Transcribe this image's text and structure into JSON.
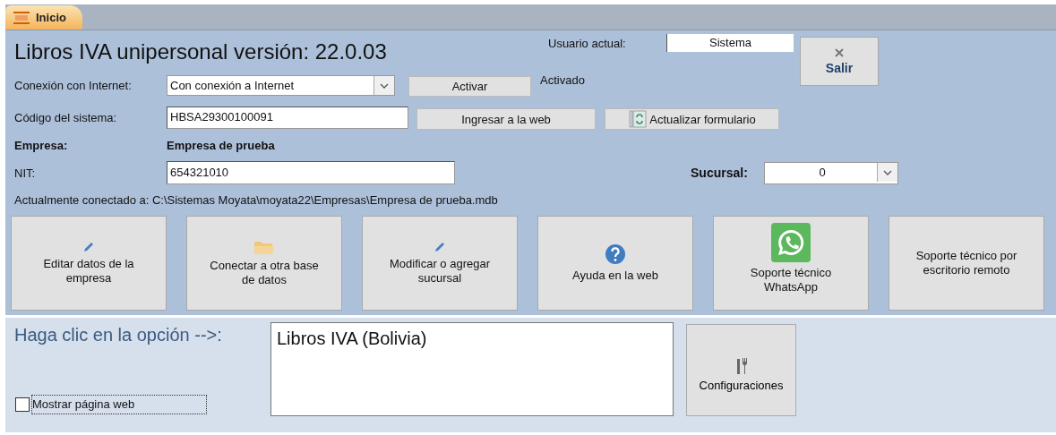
{
  "tabs": [
    {
      "label": "Inicio",
      "selected": true
    }
  ],
  "title": "Libros IVA unipersonal versión: 22.0.03",
  "user": {
    "label": "Usuario actual:",
    "value": "Sistema"
  },
  "exit_button": {
    "label": "Salir"
  },
  "connection": {
    "label": "Conexión con Internet:",
    "value": "Con conexión a Internet",
    "button": "Activar",
    "status": "Activado"
  },
  "system_code": {
    "label": "Código del sistema:",
    "value": "HBSA29300100091",
    "web_button": "Ingresar a la web",
    "refresh_button": "Actualizar formulario"
  },
  "company": {
    "label": "Empresa:",
    "value": "Empresa de prueba"
  },
  "nit": {
    "label": "NIT:",
    "value": "654321010"
  },
  "branch": {
    "label": "Sucursal:",
    "value": "0"
  },
  "connected_to": "Actualmente conectado a: C:\\Sistemas Moyata\\moyata22\\Empresas\\Empresa de prueba.mdb",
  "actions": [
    {
      "label": "Editar datos de la empresa",
      "kind": "pencil"
    },
    {
      "label": "Conectar a otra base de datos",
      "kind": "folder"
    },
    {
      "label": "Modificar o agregar sucursal",
      "kind": "pencil"
    },
    {
      "label": "Ayuda en la web",
      "kind": "help"
    },
    {
      "label": "Soporte técnico WhatsApp",
      "kind": "whatsapp"
    },
    {
      "label": "Soporte técnico por escritorio remoto",
      "kind": "text"
    }
  ],
  "prompt": "Haga clic en la opción -->:",
  "options": [
    {
      "label": "Libros IVA (Bolivia)",
      "selected": false
    }
  ],
  "settings_button": "Configuraciones",
  "show_web": {
    "label": "Mostrar página web",
    "checked": false
  }
}
